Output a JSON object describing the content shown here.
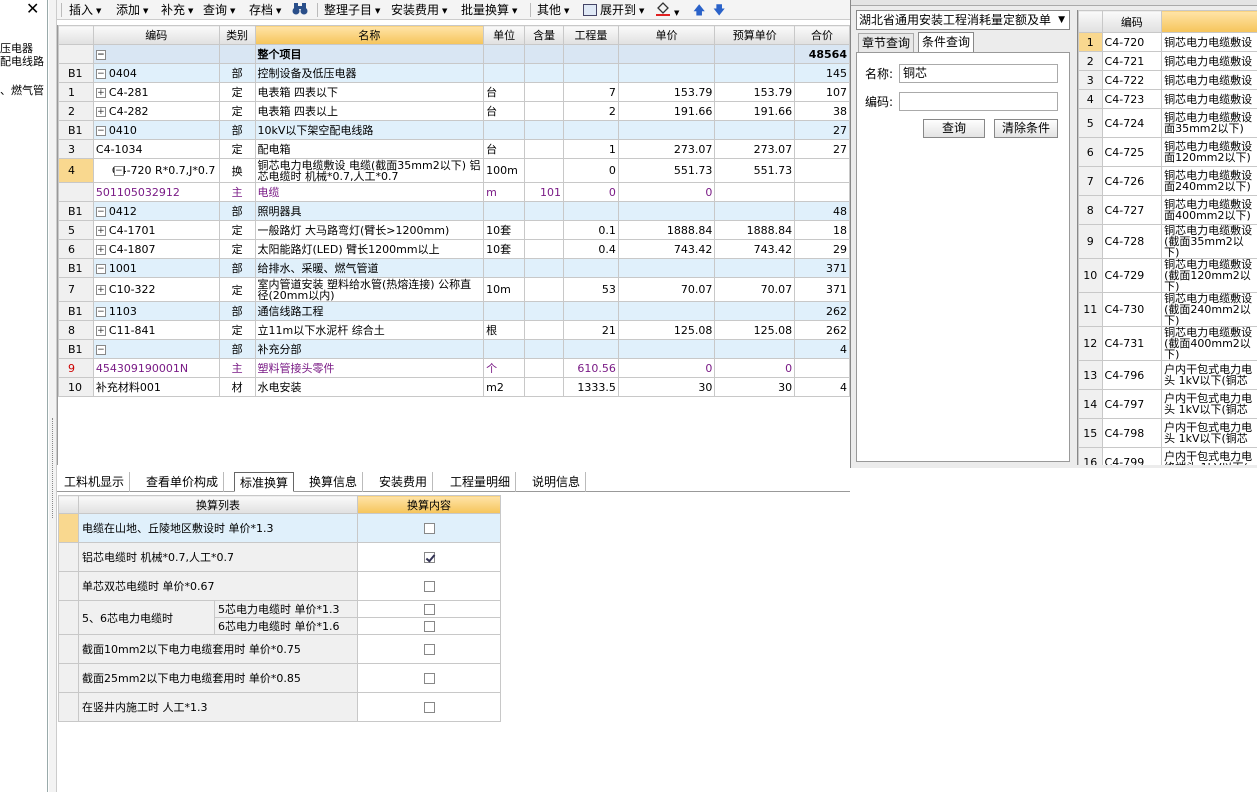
{
  "left": {
    "close_glyph": "✕",
    "lines": [
      "压电器",
      "配电线路",
      "、燃气管"
    ]
  },
  "toolbar": {
    "insert": "插入",
    "add": "添加",
    "supplement": "补充",
    "query": "查询",
    "archive": "存档",
    "organize": "整理子目",
    "install_fee": "安装费用",
    "batch_convert": "批量换算",
    "other": "其他",
    "expand": "展开到"
  },
  "grid": {
    "headers": {
      "code": "编码",
      "category": "类别",
      "name": "名称",
      "unit": "单位",
      "content": "含量",
      "quantity": "工程量",
      "unit_price": "单价",
      "budget_price": "预算单价",
      "total": "合价"
    },
    "total_row": {
      "name": "整个项目",
      "total": "48564"
    },
    "rows": [
      {
        "rn": "B1",
        "code": "0404",
        "type": "部",
        "name": "控制设备及低压电器",
        "unit": "",
        "content": "",
        "qty": "",
        "price": "",
        "budget": "",
        "total": "145"
      },
      {
        "rn": "1",
        "code": "C4-281",
        "type": "定",
        "name": "电表箱 四表以下",
        "unit": "台",
        "content": "",
        "qty": "7",
        "price": "153.79",
        "budget": "153.79",
        "total": "107"
      },
      {
        "rn": "2",
        "code": "C4-282",
        "type": "定",
        "name": "电表箱 四表以上",
        "unit": "台",
        "content": "",
        "qty": "2",
        "price": "191.66",
        "budget": "191.66",
        "total": "38"
      },
      {
        "rn": "B1",
        "code": "0410",
        "type": "部",
        "name": "10kV以下架空配电线路",
        "unit": "",
        "content": "",
        "qty": "",
        "price": "",
        "budget": "",
        "total": "27"
      },
      {
        "rn": "3",
        "code": "C4-1034",
        "type": "定",
        "name": "配电箱",
        "unit": "台",
        "content": "",
        "qty": "1",
        "price": "273.07",
        "budget": "273.07",
        "total": "27"
      },
      {
        "rn": "4",
        "code": "C4-720 R*0.7,J*0.7",
        "type": "换",
        "name": "铜芯电力电缆敷设 电缆(截面35mm2以下) 铝芯电缆时 机械*0.7,人工*0.7",
        "unit": "100m",
        "content": "",
        "qty": "0",
        "price": "551.73",
        "budget": "551.73",
        "total": ""
      },
      {
        "rn": "",
        "code": "501105032912",
        "type": "主",
        "name": "电缆",
        "unit": "m",
        "content": "101",
        "qty": "0",
        "price": "0",
        "budget": "",
        "total": ""
      },
      {
        "rn": "B1",
        "code": "0412",
        "type": "部",
        "name": "照明器具",
        "unit": "",
        "content": "",
        "qty": "",
        "price": "",
        "budget": "",
        "total": "48"
      },
      {
        "rn": "5",
        "code": "C4-1701",
        "type": "定",
        "name": "一般路灯 大马路弯灯(臂长>1200mm)",
        "unit": "10套",
        "content": "",
        "qty": "0.1",
        "price": "1888.84",
        "budget": "1888.84",
        "total": "18"
      },
      {
        "rn": "6",
        "code": "C4-1807",
        "type": "定",
        "name": "太阳能路灯(LED) 臂长1200mm以上",
        "unit": "10套",
        "content": "",
        "qty": "0.4",
        "price": "743.42",
        "budget": "743.42",
        "total": "29"
      },
      {
        "rn": "B1",
        "code": "1001",
        "type": "部",
        "name": "给排水、采暖、燃气管道",
        "unit": "",
        "content": "",
        "qty": "",
        "price": "",
        "budget": "",
        "total": "371"
      },
      {
        "rn": "7",
        "code": "C10-322",
        "type": "定",
        "name": "室内管道安装 塑料给水管(热熔连接) 公称直径(20mm以内)",
        "unit": "10m",
        "content": "",
        "qty": "53",
        "price": "70.07",
        "budget": "70.07",
        "total": "371"
      },
      {
        "rn": "B1",
        "code": "1103",
        "type": "部",
        "name": "通信线路工程",
        "unit": "",
        "content": "",
        "qty": "",
        "price": "",
        "budget": "",
        "total": "262"
      },
      {
        "rn": "8",
        "code": "C11-841",
        "type": "定",
        "name": "立11m以下水泥杆 综合土",
        "unit": "根",
        "content": "",
        "qty": "21",
        "price": "125.08",
        "budget": "125.08",
        "total": "262"
      },
      {
        "rn": "B1",
        "code": "",
        "type": "部",
        "name": "补充分部",
        "unit": "",
        "content": "",
        "qty": "",
        "price": "",
        "budget": "",
        "total": "4"
      },
      {
        "rn": "9",
        "code": "454309190001N",
        "type": "主",
        "name": "塑料管接头零件",
        "unit": "个",
        "content": "",
        "qty": "610.56",
        "price": "0",
        "budget": "0",
        "total": ""
      },
      {
        "rn": "10",
        "code": "补充材料001",
        "type": "材",
        "name": "水电安装",
        "unit": "m2",
        "content": "",
        "qty": "1333.5",
        "price": "30",
        "budget": "30",
        "total": "4"
      }
    ]
  },
  "bottom_tabs": [
    "工料机显示",
    "查看单价构成",
    "标准换算",
    "换算信息",
    "安装费用",
    "工程量明细",
    "说明信息"
  ],
  "conversion": {
    "header_list": "换算列表",
    "header_content": "换算内容",
    "items": [
      {
        "label": "电缆在山地、丘陵地区敷设时 单价*1.3",
        "checked": false
      },
      {
        "label": "铝芯电缆时 机械*0.7,人工*0.7",
        "checked": true
      },
      {
        "label": "单芯双芯电缆时 单价*0.67",
        "checked": false
      },
      {
        "label": "5、6芯电力电缆时",
        "sub": [
          "5芯电力电缆时 单价*1.3",
          "6芯电力电缆时 单价*1.6"
        ],
        "checked": false
      },
      {
        "label": "截面10mm2以下电力电缆套用时 单价*0.75",
        "checked": false
      },
      {
        "label": "截面25mm2以下电力电缆套用时 单价*0.85",
        "checked": false
      },
      {
        "label": "在竖井内施工时 人工*1.3",
        "checked": false
      }
    ]
  },
  "right_panel": {
    "library": "湖北省通用安装工程消耗量定额及单",
    "tab_chapter": "章节查询",
    "tab_condition": "条件查询",
    "name_label": "名称:",
    "name_value": "铜芯",
    "code_label": "编码:",
    "code_value": "",
    "query_button": "查询",
    "clear_button": "清除条件",
    "list_header_code": "编码",
    "list_header_name": "",
    "list": [
      {
        "n": "1",
        "code": "C4-720",
        "name": "铜芯电力电缆敷设"
      },
      {
        "n": "2",
        "code": "C4-721",
        "name": "铜芯电力电缆敷设"
      },
      {
        "n": "3",
        "code": "C4-722",
        "name": "铜芯电力电缆敷设"
      },
      {
        "n": "4",
        "code": "C4-723",
        "name": "铜芯电力电缆敷设"
      },
      {
        "n": "5",
        "code": "C4-724",
        "name": "铜芯电力电缆敷设 面35mm2以下)"
      },
      {
        "n": "6",
        "code": "C4-725",
        "name": "铜芯电力电缆敷设 面120mm2以下)"
      },
      {
        "n": "7",
        "code": "C4-726",
        "name": "铜芯电力电缆敷设 面240mm2以下)"
      },
      {
        "n": "8",
        "code": "C4-727",
        "name": "铜芯电力电缆敷设 面400mm2以下)"
      },
      {
        "n": "9",
        "code": "C4-728",
        "name": "铜芯电力电缆敷设 (截面35mm2以下)"
      },
      {
        "n": "10",
        "code": "C4-729",
        "name": "铜芯电力电缆敷设 (截面120mm2以下)"
      },
      {
        "n": "11",
        "code": "C4-730",
        "name": "铜芯电力电缆敷设 (截面240mm2以下)"
      },
      {
        "n": "12",
        "code": "C4-731",
        "name": "铜芯电力电缆敷设 (截面400mm2以下)"
      },
      {
        "n": "13",
        "code": "C4-796",
        "name": "户内干包式电力电 头 1kV以下(铜芯"
      },
      {
        "n": "14",
        "code": "C4-797",
        "name": "户内干包式电力电 头 1kV以下(铜芯"
      },
      {
        "n": "15",
        "code": "C4-798",
        "name": "户内干包式电力电 头 1kV以下(铜芯"
      },
      {
        "n": "16",
        "code": "C4-799",
        "name": "户内干包式电力电 终端头 1kV以下("
      }
    ]
  },
  "colors": {
    "accent_header": "#f5c45a",
    "group_row": "#e0f0fb",
    "main_material_text": "#7a1b86"
  }
}
